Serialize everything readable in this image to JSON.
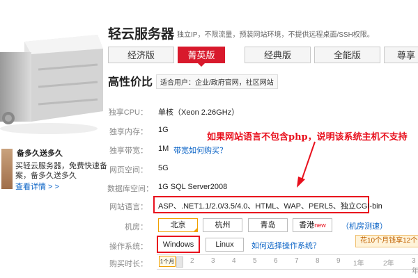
{
  "product": {
    "title": "轻云服务器",
    "description": "独立IP，不限流量，预装网站环境，不提供远程桌面/SSH权限。"
  },
  "tabs": [
    {
      "label": "经济版",
      "active": false
    },
    {
      "label": "菁英版",
      "active": true
    },
    {
      "label": "经典版",
      "active": false
    },
    {
      "label": "全能版",
      "active": false
    },
    {
      "label": "尊享",
      "active": false
    }
  ],
  "promo": {
    "title": "备多久送多久",
    "line1": "买轻云服务器，免费快速备",
    "line2": "案，备多久送多久",
    "more": "查看详情 > >"
  },
  "section": {
    "title": "高性价比",
    "audience": "适合用户：企业/政府官网，社区网站"
  },
  "specs": {
    "cpu": {
      "label": "独享CPU：",
      "value": "单核（Xeon 2.26GHz）"
    },
    "memory": {
      "label": "独享内存：",
      "value": "1G"
    },
    "bandwidth": {
      "label": "独享带宽：",
      "value": "1M",
      "link": "带宽如何购买？"
    },
    "webspace": {
      "label": "网页空间：",
      "value": "5G"
    },
    "database": {
      "label": "数据库空间：",
      "value": "1G SQL Server2008"
    },
    "language": {
      "label": "网站语言：",
      "value": "ASP、.NET1.1/2.0/3.5/4.0、HTML、WAP、PERL5、独立CGI-bin"
    }
  },
  "annotation": "如果网站语言不包含php，说明该系统主机不支持",
  "datacenter": {
    "label": "机房：",
    "options": [
      {
        "label": "北京",
        "selected": true
      },
      {
        "label": "杭州",
        "selected": false
      },
      {
        "label": "青岛",
        "selected": false
      },
      {
        "label": "香港",
        "tag": "new",
        "selected": false
      }
    ],
    "test_link": "（机房测速）"
  },
  "os": {
    "label": "操作系统：",
    "options": [
      {
        "label": "Windows",
        "selected": true
      },
      {
        "label": "Linux",
        "selected": false
      }
    ],
    "help_link": "如何选择操作系统？"
  },
  "discount": "花10个月钱享12个",
  "duration": {
    "label": "购买时长：",
    "selected": "1个月",
    "ticks": [
      "2",
      "3",
      "4",
      "5",
      "6",
      "7",
      "8",
      "9",
      "1年",
      "2年",
      "3年"
    ]
  },
  "colors": {
    "accent_red": "#d8192c",
    "highlight_red": "#e8101d",
    "link_blue": "#0a63c6",
    "selected_orange": "#f0a000"
  },
  "icons": {
    "arrow": "arrow-down-left-icon",
    "server": "server-product-icon",
    "gift": "gift-box-icon"
  }
}
